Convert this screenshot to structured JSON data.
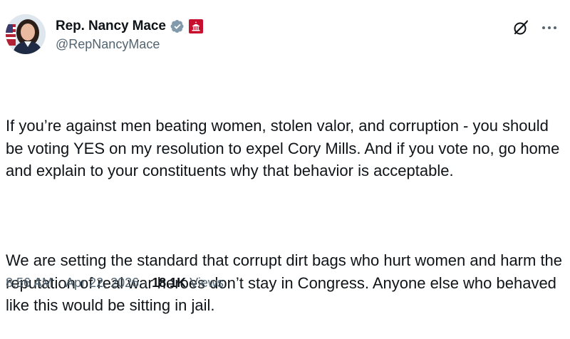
{
  "author": {
    "name": "Rep. Nancy Mace",
    "handle": "@RepNancyMace"
  },
  "icons": {
    "verified": "verified-badge-icon",
    "affiliation": "us-house-affiliation-icon",
    "grok": "grok-icon",
    "more": "more-options-icon"
  },
  "colors": {
    "verified_badge": "#829aab",
    "affiliation_badge": "#c8102e",
    "text_primary": "#0f1419",
    "text_secondary": "#536471"
  },
  "tweet": {
    "paragraphs": [
      "If you’re against men beating women, stolen valor, and corruption - you should be voting YES on my resolution to expel Cory Mills. And if you vote no, go home and explain to your constituents why that behavior is acceptable.",
      "We are setting the standard that corrupt dirt bags who hurt women and harm the reputation of real war heroes don’t stay in Congress. Anyone else who behaved like this would be sitting in jail."
    ]
  },
  "meta": {
    "time": "8:56 AM",
    "separator": "·",
    "date": "Apr 22, 2026",
    "views_count": "18.1K",
    "views_label": "Views"
  }
}
